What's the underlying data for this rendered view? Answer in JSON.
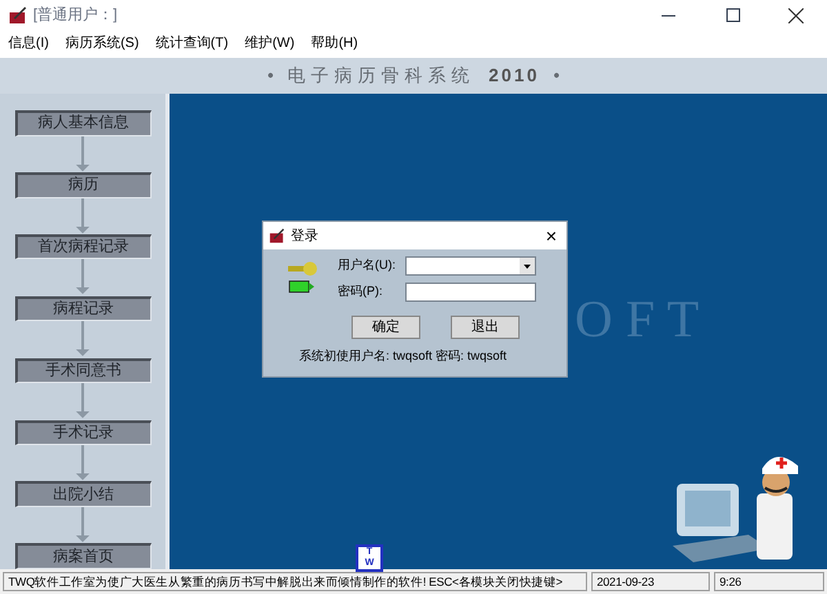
{
  "window": {
    "title": "[普通用户：]"
  },
  "menu": [
    "信息(I)",
    "病历系统(S)",
    "统计查询(T)",
    "维护(W)",
    "帮助(H)"
  ],
  "banner": {
    "bullet_left": "•",
    "title": "电子病历骨科系统",
    "year": "2010",
    "bullet_right": "•"
  },
  "flow": [
    "病人基本信息",
    "病历",
    "首次病程记录",
    "病程记录",
    "手术同意书",
    "手术记录",
    "出院小结",
    "病案首页"
  ],
  "background": {
    "logo_text": "O F T",
    "logo_badge": [
      "T",
      "W"
    ]
  },
  "dialog": {
    "title": "登录",
    "close": "×",
    "fields": [
      {
        "kind": "combo",
        "label": "用户名(U):"
      },
      {
        "kind": "text",
        "label": "密码(P):"
      }
    ],
    "buttons": [
      "确定",
      "退出"
    ],
    "hint": "系统初使用户名: twqsoft 密码: twqsoft"
  },
  "status_bar": [
    "TWQ软件工作室为使广大医生从繁重的病历书写中解脱出来而倾情制作的软件! ESC<各模块关闭快捷键>",
    "2021-09-23",
    "9:26"
  ]
}
